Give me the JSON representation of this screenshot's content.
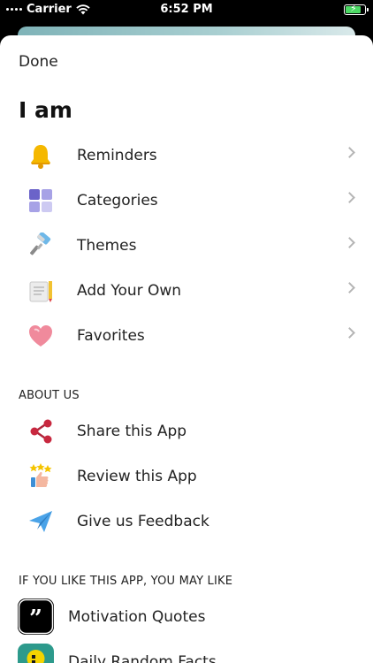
{
  "status": {
    "carrier": "Carrier",
    "time": "6:52 PM"
  },
  "sheet": {
    "done_label": "Done",
    "title": "I am"
  },
  "menu": [
    {
      "label": "Reminders",
      "icon": "bell-icon"
    },
    {
      "label": "Categories",
      "icon": "grid-icon"
    },
    {
      "label": "Themes",
      "icon": "paint-roller-icon"
    },
    {
      "label": "Add Your Own",
      "icon": "notepad-pencil-icon"
    },
    {
      "label": "Favorites",
      "icon": "heart-icon"
    }
  ],
  "about": {
    "title": "ABOUT US",
    "items": [
      {
        "label": "Share this App",
        "icon": "share-icon"
      },
      {
        "label": "Review this App",
        "icon": "thumbs-up-stars-icon"
      },
      {
        "label": "Give us Feedback",
        "icon": "paper-plane-icon"
      }
    ]
  },
  "more_apps": {
    "title": "IF YOU LIKE THIS APP, YOU MAY LIKE",
    "items": [
      {
        "label": "Motivation Quotes",
        "icon": "quote-marks-icon",
        "color": "#000000"
      },
      {
        "label": "Daily Random Facts",
        "icon": "bulb-icon",
        "color": "#2d9a8c"
      }
    ]
  }
}
